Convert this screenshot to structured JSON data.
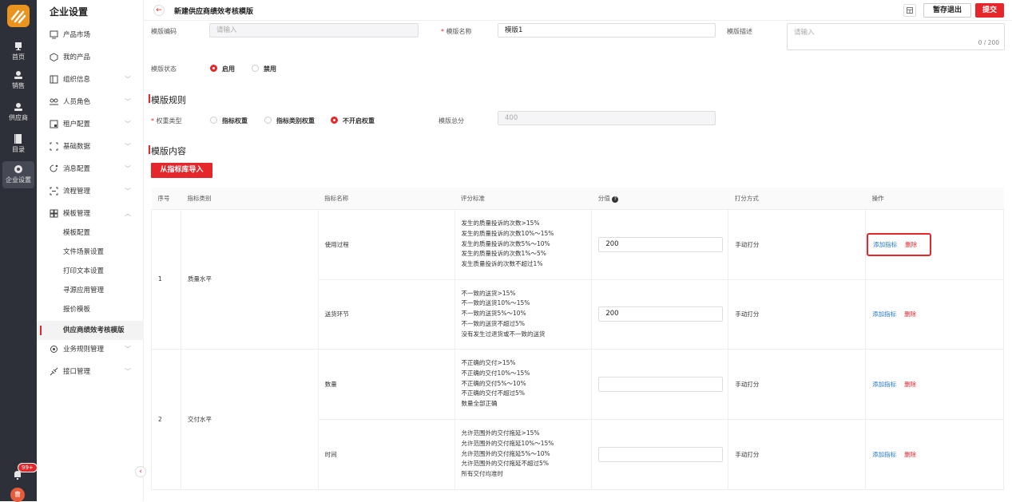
{
  "rail": {
    "items": [
      {
        "label": "首页",
        "icon": "monitor-icon"
      },
      {
        "label": "销售",
        "icon": "person-icon"
      },
      {
        "label": "供应商",
        "icon": "person-icon"
      },
      {
        "label": "目录",
        "icon": "book-icon"
      },
      {
        "label": "企业设置",
        "icon": "gear-icon"
      }
    ],
    "badge": "99+",
    "avatar": "曹"
  },
  "sidebar": {
    "title": "企业设置",
    "menu": [
      {
        "label": "产品市场",
        "icon": "monitor-icon",
        "chevron": ""
      },
      {
        "label": "我的产品",
        "icon": "cube-icon",
        "chevron": ""
      },
      {
        "label": "组织信息",
        "icon": "org-icon",
        "chevron": "﹀"
      },
      {
        "label": "人员角色",
        "icon": "users-icon",
        "chevron": "﹀"
      },
      {
        "label": "租户配置",
        "icon": "tenant-icon",
        "chevron": "﹀"
      },
      {
        "label": "基础数据",
        "icon": "data-icon",
        "chevron": "﹀"
      },
      {
        "label": "消息配置",
        "icon": "message-icon",
        "chevron": "﹀"
      },
      {
        "label": "流程管理",
        "icon": "flow-icon",
        "chevron": "﹀"
      },
      {
        "label": "模板管理",
        "icon": "template-icon",
        "chevron": "︿"
      }
    ],
    "sub": [
      "模板配置",
      "文件场景设置",
      "打印文本设置",
      "寻源应用管理",
      "报价模板",
      "供应商绩效考核模版"
    ],
    "menu2": [
      {
        "label": "业务规则管理",
        "icon": "rule-icon",
        "chevron": "﹀"
      },
      {
        "label": "接口管理",
        "icon": "api-icon",
        "chevron": "﹀"
      }
    ]
  },
  "header": {
    "title": "新建供应商绩效考核模版",
    "save_label": "暂存退出",
    "submit_label": "提交"
  },
  "form": {
    "code_label": "模版编码",
    "code_placeholder": "请输入",
    "name_label": "模版名称",
    "name_value": "模版1",
    "desc_label": "模版描述",
    "desc_placeholder": "请输入",
    "desc_count": "0 / 200",
    "status_label": "模版状态",
    "status_on": "启用",
    "status_off": "禁用"
  },
  "rules": {
    "section_title": "模版规则",
    "weight_label": "权重类型",
    "opt1": "指标权重",
    "opt2": "指标类别权重",
    "opt3": "不开启权重",
    "total_label": "模版总分",
    "total_value": "400"
  },
  "content": {
    "section_title": "模版内容",
    "import_label": "从指标库导入",
    "columns": [
      "序号",
      "指标类别",
      "指标名称",
      "评分标准",
      "分值",
      "打分方式",
      "操作"
    ],
    "add_label": "添加指标",
    "del_label": "删除",
    "groups": [
      {
        "no": "1",
        "category": "质量水平",
        "rows": [
          {
            "name": "使用过程",
            "score": "200",
            "method": "手动打分",
            "criteria": [
              "发生的质量投诉的次数>15%",
              "发生的质量投诉的次数10%～15%",
              "发生的质量投诉的次数5%～10%",
              "发生的质量投诉的次数1%～5%",
              "发生质量投诉的次数不超过1%"
            ]
          },
          {
            "name": "送货环节",
            "score": "200",
            "method": "手动打分",
            "criteria": [
              "不一致的送货>15%",
              "不一致的送货10%～15%",
              "不一致的送货5%～10%",
              "不一致的送货不超过5%",
              "没有发生过退货或不一致的送货"
            ]
          }
        ]
      },
      {
        "no": "2",
        "category": "交付水平",
        "rows": [
          {
            "name": "数量",
            "score": "",
            "method": "手动打分",
            "criteria": [
              "不正确的交付>15%",
              "不正确的交付10%～15%",
              "不正确的交付5%～10%",
              "不正确的交付不超过5%",
              "数量全部正确"
            ]
          },
          {
            "name": "时间",
            "score": "",
            "method": "手动打分",
            "criteria": [
              "允许范围外的交付拖延>15%",
              "允许范围外的交付拖延10%～15%",
              "允许范围外的交付拖延5%～10%",
              "允许范围外的交付拖延不超过5%",
              "所有交付均准时"
            ]
          }
        ]
      }
    ]
  },
  "colors": {
    "accent": "#e5262b",
    "link": "#1f74d6",
    "rail": "#2d3038"
  }
}
